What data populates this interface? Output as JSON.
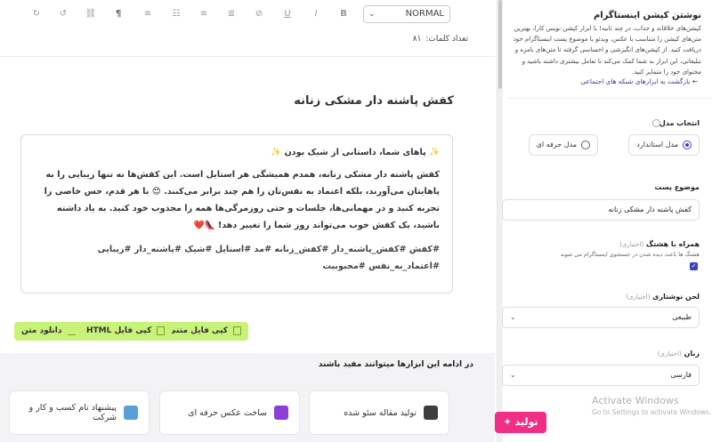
{
  "toolbar": {
    "style_value": "NORMAL",
    "icons": [
      "redo-icon",
      "undo-icon",
      "link-icon",
      "rtl-paragraph-icon",
      "align-icon",
      "ordered-list-icon",
      "unordered-list-icon",
      "align-right-icon",
      "clear-format-icon",
      "underline-icon",
      "italic-icon",
      "bold-icon"
    ]
  },
  "editor": {
    "word_count_label": "تعداد کلمات:",
    "word_count": "۸۱",
    "title": "کفش پاشنه دار مشکی زنانه",
    "hook": "✨ پاهای شما، داستانی از شیک بودن ✨",
    "body": "کفش پاشنه دار مشکی زنانه، همدم همیشگی هر استایل است. این کفش‌ها نه تنها زیبایی را به پاهایتان می‌آورند، بلکه اعتماد به نفس‌تان را هم چند برابر می‌کنند. 😍 با هر قدم، حس خاصی را تجربه کنید و در مهمانی‌ها، جلسات و حتی روزمرگی‌ها همه را مجذوب خود کنید. به یاد داشته باشید، یک کفش خوب می‌تواند روز شما را تغییر دهد! 👠❤️",
    "hashtags": "#کفش #کفش_پاشنه_دار #کفش_زنانه #مد #استایل #شیک #پاشنه_دار #زیبایی #اعتماد_به_نفس #محبوبیت"
  },
  "actions": {
    "copy_text": "کپی فایل متنی",
    "copy_html": "کپی فایل HTML",
    "download": "دانلود متن"
  },
  "tools": {
    "title": "در ادامه این ابزارها میتوانند مفید باشند",
    "cards": [
      {
        "label": "تولید مقاله سئو شده"
      },
      {
        "label": "ساخت عکس حرفه ای"
      },
      {
        "label": "پیشنهاد نام کسب و کار و شرکت"
      }
    ]
  },
  "sidebar": {
    "title": "نوشتن کپشن اینستاگرام",
    "description": "کپشن‌های خلاقانه و جذاب، در چند ثانیه! با ابزار کپشن نویس کارا، بهترین متن‌های کپشن را متناسب با عکس، ویدئو یا موضوع پست اینستاگرام خود دریافت کنید. از کپشن‌های انگیزشی و احساسی گرفته تا متن‌های بامزه و تبلیغاتی، این ابزار به شما کمک می‌کند تا تعامل بیشتری داشته باشید و محتوای خود را متمایز کنید.",
    "back_link": "بازگشت به ابزارهای شبکه های اجتماعی",
    "mode_label": "انتخاب مدل",
    "mode_standard": "مدل استاندارد",
    "mode_pro": "مدل حرفه ای",
    "topic_label": "موضوع پست",
    "topic_value": "کفش پاشنه دار مشکی زنانه",
    "hashtag_label": "همراه با هشتگ",
    "optional": "(اختیاری)",
    "hashtag_hint": "هشتگ ها باعث دیده شدن در جستجوی اینستاگرام می شوند",
    "tone_label": "لحن نوشتاری",
    "tone_value": "طبیعی",
    "lang_label": "زبان",
    "lang_value": "فارسی",
    "generate": "تولید"
  },
  "watermark": {
    "line1": "Activate Windows",
    "line2": "Go to Settings to activate Windows."
  },
  "colors": {
    "accent_green": "#c9f27a",
    "generate_pink": "#ef2f86",
    "radio_purple": "#4a37c9"
  }
}
